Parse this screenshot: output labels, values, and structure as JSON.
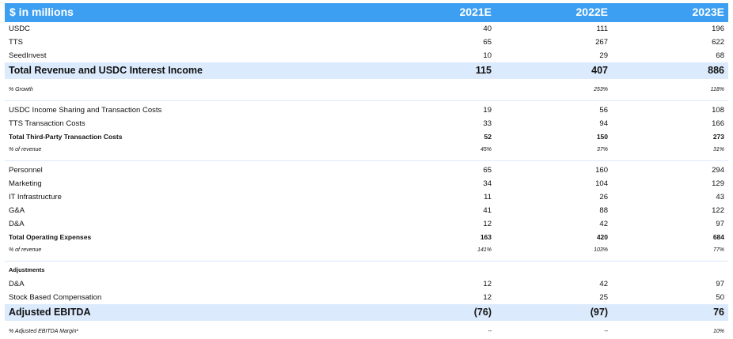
{
  "header": {
    "label": "$ in millions",
    "years": [
      "2021E",
      "2022E",
      "2023E"
    ]
  },
  "revenue": {
    "items": [
      {
        "label": "USDC",
        "values": [
          "40",
          "111",
          "196"
        ]
      },
      {
        "label": "TTS",
        "values": [
          "65",
          "267",
          "622"
        ]
      },
      {
        "label": "SeedInvest",
        "values": [
          "10",
          "29",
          "68"
        ]
      }
    ],
    "total": {
      "label": "Total Revenue and USDC Interest Income",
      "values": [
        "115",
        "407",
        "886"
      ]
    },
    "growth": {
      "label": "% Growth",
      "values": [
        "",
        "253%",
        "118%"
      ]
    }
  },
  "third_party": {
    "items": [
      {
        "label": "USDC Income Sharing and Transaction Costs",
        "values": [
          "19",
          "56",
          "108"
        ]
      },
      {
        "label": "TTS Transaction Costs",
        "values": [
          "33",
          "94",
          "166"
        ]
      }
    ],
    "total": {
      "label": "Total Third-Party Transaction Costs",
      "values": [
        "52",
        "150",
        "273"
      ]
    },
    "pct": {
      "label": "% of revenue",
      "values": [
        "45%",
        "37%",
        "31%"
      ]
    }
  },
  "opex": {
    "items": [
      {
        "label": "Personnel",
        "values": [
          "65",
          "160",
          "294"
        ]
      },
      {
        "label": "Marketing",
        "values": [
          "34",
          "104",
          "129"
        ]
      },
      {
        "label": "IT Infrastructure",
        "values": [
          "11",
          "26",
          "43"
        ]
      },
      {
        "label": "G&A",
        "values": [
          "41",
          "88",
          "122"
        ]
      },
      {
        "label": "D&A",
        "values": [
          "12",
          "42",
          "97"
        ]
      }
    ],
    "total": {
      "label": "Total Operating Expenses",
      "values": [
        "163",
        "420",
        "684"
      ]
    },
    "pct": {
      "label": "% of revenue",
      "values": [
        "141%",
        "103%",
        "77%"
      ]
    }
  },
  "adjustments": {
    "heading": "Adjustments",
    "items": [
      {
        "label": "D&A",
        "values": [
          "12",
          "42",
          "97"
        ]
      },
      {
        "label": "Stock Based Compensation",
        "values": [
          "12",
          "25",
          "50"
        ]
      }
    ],
    "total": {
      "label": "Adjusted EBITDA",
      "values": [
        "(76)",
        "(97)",
        "76"
      ]
    },
    "margin": {
      "label": "% Adjusted EBITDA Margin¹",
      "values": [
        "--",
        "--",
        "10%"
      ]
    }
  },
  "colors": {
    "header_bg": "#3d9ff2",
    "highlight_bg": "#dbeafc",
    "separator": "#dbeafc"
  }
}
